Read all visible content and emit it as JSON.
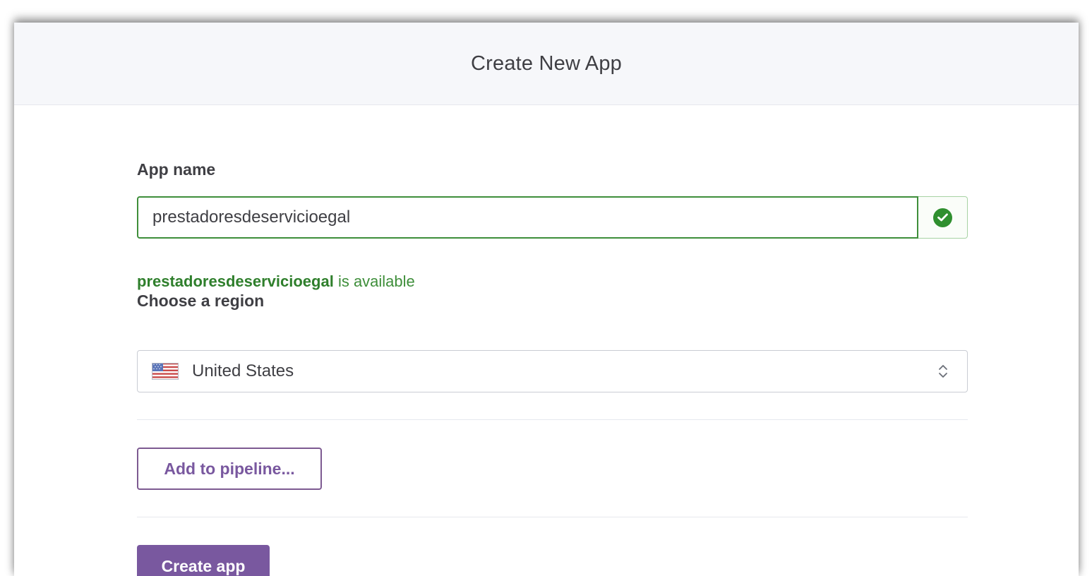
{
  "header": {
    "title": "Create New App"
  },
  "form": {
    "app_name_label": "App name",
    "app_name_value": "prestadoresdeservicioegal",
    "availability": {
      "app_name": "prestadoresdeservicioegal",
      "suffix": "is available",
      "status_icon": "check-circle-icon",
      "status_color": "#2f8f2f"
    },
    "region_label": "Choose a region",
    "region": {
      "selected": "United States",
      "flag_icon": "us-flag-icon",
      "chevron_icon": "up-down-chevron-icon"
    },
    "pipeline_button": "Add to pipeline...",
    "create_button": "Create app"
  },
  "colors": {
    "accent": "#79589f",
    "success": "#3e8e3a",
    "header_bg": "#f6f7fa"
  }
}
